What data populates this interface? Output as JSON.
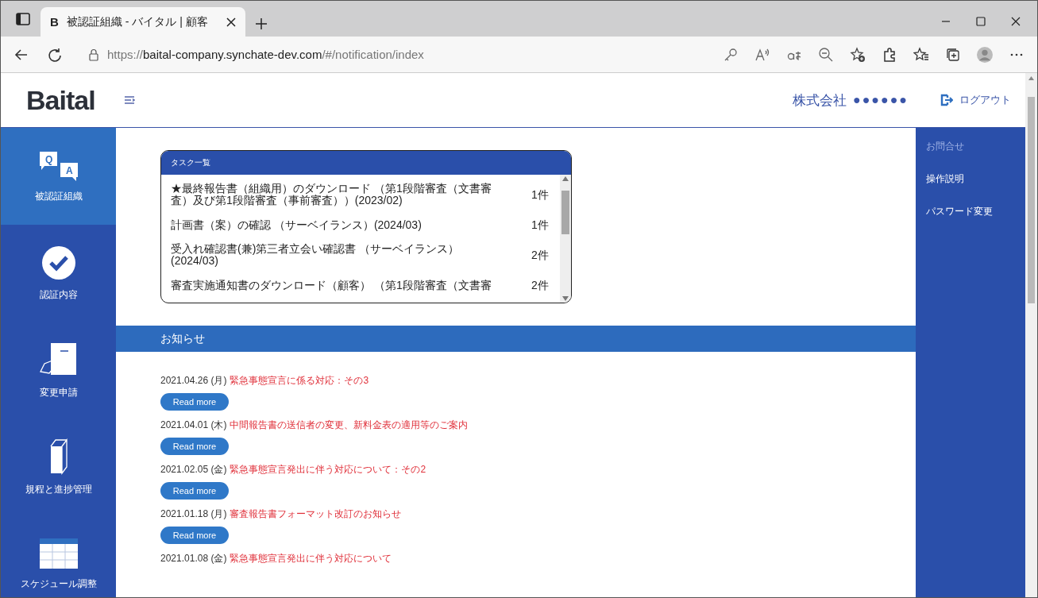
{
  "browser": {
    "tab_favicon": "B",
    "tab_title": "被認証組織 - バイタル | 顧客",
    "url_scheme": "https://",
    "url_host": "baital-company.synchate-dev.com",
    "url_path": "/#/notification/index"
  },
  "header": {
    "logo": "Baital",
    "company": "株式会社",
    "company_masked": "●●●●●●",
    "logout": "ログアウト"
  },
  "sidebar": {
    "items": [
      {
        "kind": "qa",
        "icon_letters": [
          "Q",
          "A"
        ],
        "label": "被認証組織",
        "selected": true
      },
      {
        "kind": "check",
        "label": "認証内容",
        "selected": false
      },
      {
        "kind": "form",
        "label": "変更申請",
        "selected": false
      },
      {
        "kind": "binder",
        "label": "規程と進捗管理",
        "selected": false
      },
      {
        "kind": "calendar",
        "label": "スケジュール調整",
        "selected": false
      }
    ]
  },
  "tasks": {
    "title": "タスク一覧",
    "rows": [
      {
        "text": "★最終報告書（組織用）のダウンロード （第1段階審査（文書審査）及び第1段階審査（事前審査））(2023/02)",
        "count": "1件"
      },
      {
        "text": "計画書（案）の確認 （サーベイランス）(2024/03)",
        "count": "1件"
      },
      {
        "text": "受入れ確認書(兼)第三者立会い確認書 （サーベイランス）(2024/03)",
        "count": "2件"
      },
      {
        "text": "審査実施通知書のダウンロード（顧客） （第1段階審査（文書審",
        "count": "2件"
      }
    ]
  },
  "news": {
    "title": "お知らせ",
    "items": [
      {
        "date": "2021.04.26 (月)",
        "title": "緊急事態宣言に係る対応：その3",
        "button": "Read more"
      },
      {
        "date": "2021.04.01 (木)",
        "title": "中間報告書の送信者の変更、新料金表の適用等のご案内",
        "button": "Read more"
      },
      {
        "date": "2021.02.05 (金)",
        "title": "緊急事態宣言発出に伴う対応について：その2",
        "button": "Read more"
      },
      {
        "date": "2021.01.18 (月)",
        "title": "審査報告書フォーマット改訂のお知らせ",
        "button": "Read more"
      },
      {
        "date": "2021.01.08 (金)",
        "title": "緊急事態宣言発出に伴う対応について"
      }
    ]
  },
  "right_menu": {
    "items": [
      {
        "label": "お問合せ",
        "dimmed": true
      },
      {
        "label": "操作説明",
        "dimmed": false
      },
      {
        "label": "パスワード変更",
        "dimmed": false
      }
    ]
  }
}
